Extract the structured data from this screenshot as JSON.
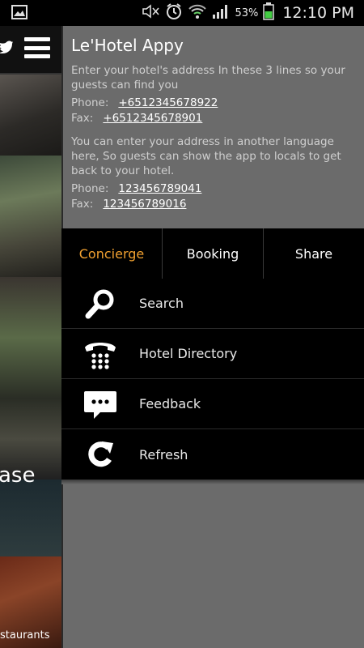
{
  "status_bar": {
    "battery_percent": "53%",
    "time": "12:10 PM",
    "icons": [
      "image-icon",
      "mute-icon",
      "alarm-icon",
      "wifi-icon",
      "signal-icon",
      "battery-icon"
    ]
  },
  "underlay": {
    "case_text": "ase",
    "restaurants_text": "staurants",
    "icons": [
      "twitter-icon",
      "menu-icon"
    ]
  },
  "drawer": {
    "hotel_name": "Le'Hotel Appy",
    "address_1": "Enter your hotel's address In these 3 lines so your guests can find you",
    "phone_label_1": "Phone:",
    "phone_1": "+6512345678922",
    "fax_label_1": "Fax:",
    "fax_1": "+6512345678901",
    "address_2": "You can enter your address in another language here, So guests can show the app to locals to get back to your hotel.",
    "phone_label_2": "Phone:",
    "phone_2": "123456789041",
    "fax_label_2": "Fax:",
    "fax_2": "123456789016"
  },
  "tabs": [
    {
      "label": "Concierge",
      "active": true
    },
    {
      "label": "Booking",
      "active": false
    },
    {
      "label": "Share",
      "active": false
    }
  ],
  "menu": [
    {
      "label": "Search",
      "icon": "search-icon"
    },
    {
      "label": "Hotel Directory",
      "icon": "phone-icon"
    },
    {
      "label": "Feedback",
      "icon": "chat-bubble-icon"
    },
    {
      "label": "Refresh",
      "icon": "refresh-icon"
    }
  ],
  "colors": {
    "accent": "#f0a030",
    "panel": "#6b6b6b",
    "menu_bg": "#000000"
  }
}
